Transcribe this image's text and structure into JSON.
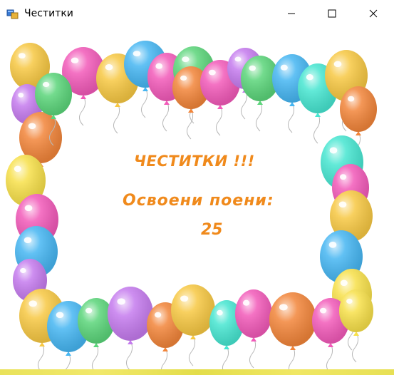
{
  "window": {
    "title": "Честитки",
    "icon": "windows-app-icon",
    "controls": [
      "minimize-icon",
      "maximize-icon",
      "close-icon"
    ]
  },
  "content": {
    "heading": "ЧЕСТИТКИ !!!",
    "points_label": "Освоени поени:",
    "points_value": "25",
    "text_color": "#f08a1c",
    "background_image": "balloon-frame"
  },
  "colors": {
    "balloons": [
      "#f7c843",
      "#f25ab9",
      "#46b6f2",
      "#5bd57a",
      "#f2853a",
      "#c57bee",
      "#47e6d1",
      "#f7e04a"
    ]
  }
}
